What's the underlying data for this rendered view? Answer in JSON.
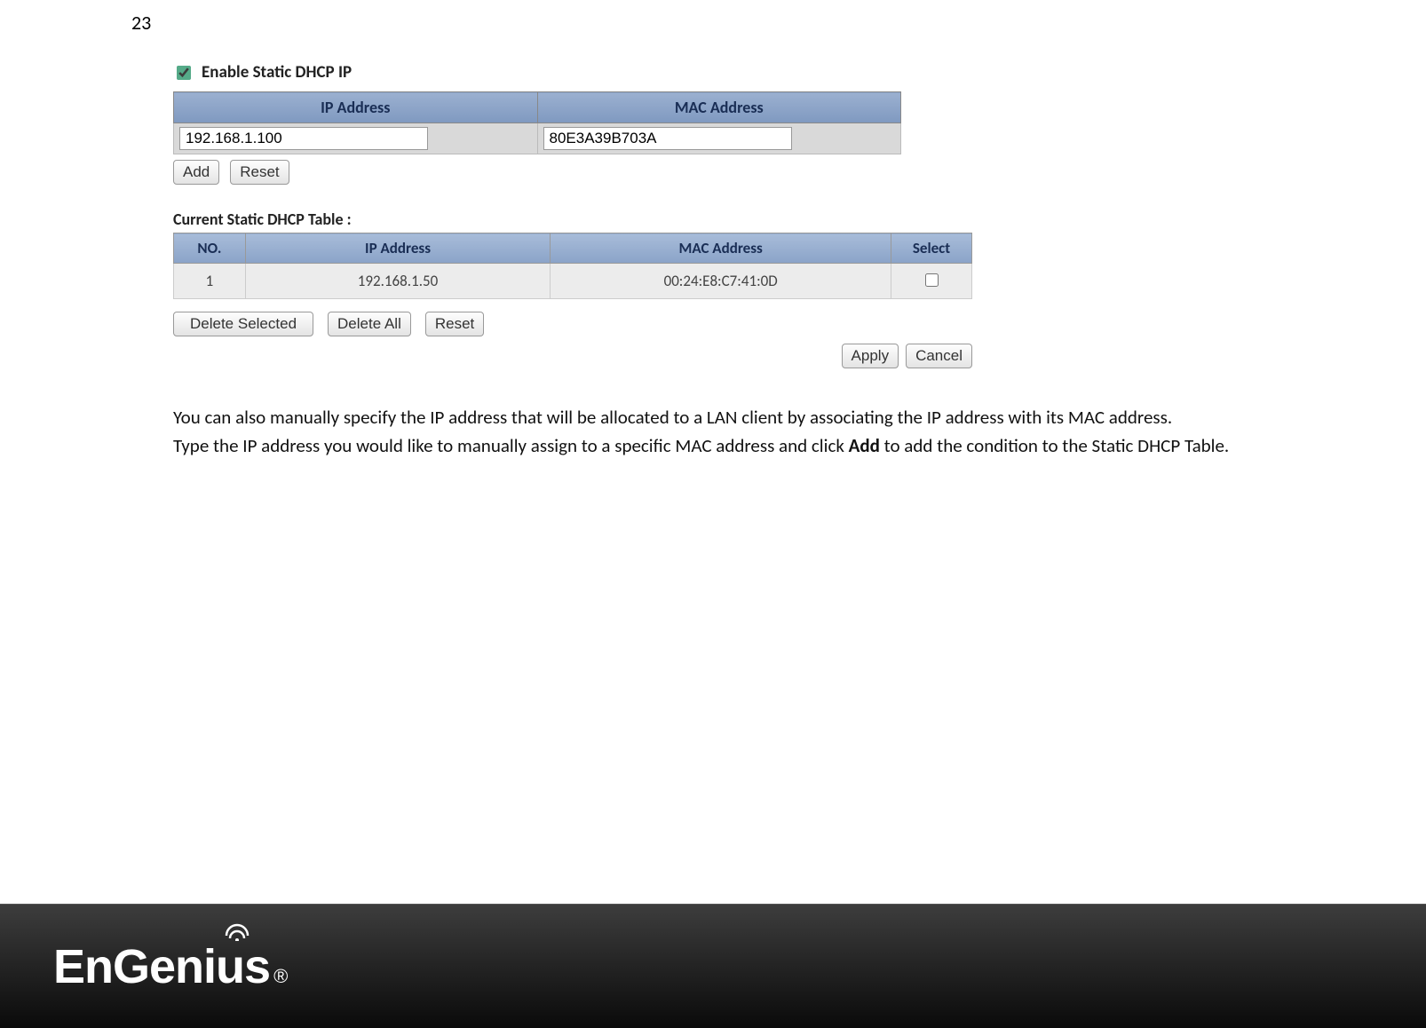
{
  "page_number": "23",
  "enable_section": {
    "checkbox_checked": true,
    "label": "Enable Static DHCP IP"
  },
  "input_table": {
    "headers": {
      "ip": "IP Address",
      "mac": "MAC Address"
    },
    "ip_value": "192.168.1.100",
    "mac_value": "80E3A39B703A"
  },
  "buttons": {
    "add": "Add",
    "reset": "Reset",
    "delete_selected": "Delete Selected",
    "delete_all": "Delete All",
    "reset2": "Reset",
    "apply": "Apply",
    "cancel": "Cancel"
  },
  "table_title": "Current Static DHCP Table :",
  "dhcp_table": {
    "headers": {
      "no": "NO.",
      "ip": "IP Address",
      "mac": "MAC Address",
      "select": "Select"
    },
    "rows": [
      {
        "no": "1",
        "ip": "192.168.1.50",
        "mac": "00:24:E8:C7:41:0D",
        "selected": false
      }
    ]
  },
  "prose": {
    "p1": "You can also manually specify the IP address that will be allocated to a LAN client by associating the IP address with its MAC address.",
    "p2a": "Type the IP address you would like to manually assign to a specific MAC address and click ",
    "p2_bold": "Add",
    "p2b": " to add the condition to the Static DHCP Table."
  },
  "footer": {
    "brand": "EnGenius",
    "registered": "®"
  }
}
